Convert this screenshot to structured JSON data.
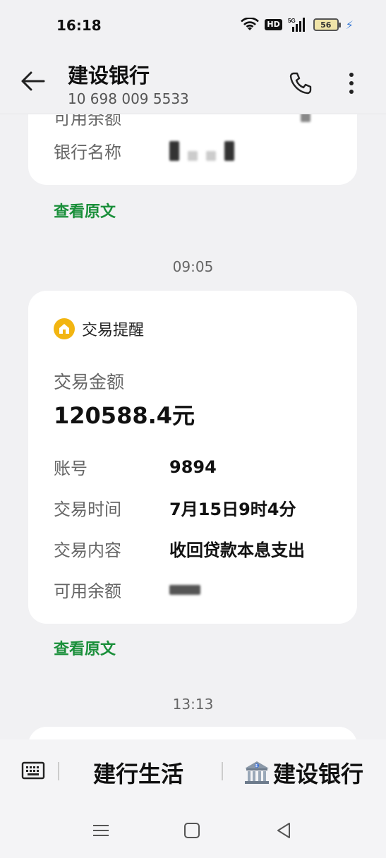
{
  "status_bar": {
    "time": "16:18",
    "hd_label": "HD",
    "network": "5G",
    "battery": "56"
  },
  "header": {
    "title": "建设银行",
    "subtitle": "10 698 009 5533"
  },
  "messages": {
    "top_card": {
      "partial_label": "可用余额",
      "bank_name_label": "银行名称"
    },
    "view_original_1": "查看原文",
    "timestamp_1": "09:05",
    "notification": {
      "title": "交易提醒",
      "amount_label": "交易金额",
      "amount": "120588.4元",
      "rows": [
        {
          "label": "账号",
          "value": "9894"
        },
        {
          "label": "交易时间",
          "value": "7月15日9时4分"
        },
        {
          "label": "交易内容",
          "value": "收回贷款本息支出"
        },
        {
          "label": "可用余额",
          "value": ""
        }
      ]
    },
    "view_original_2": "查看原文",
    "timestamp_2": "13:13"
  },
  "bottom_menu": {
    "item1": "建行生活",
    "item2": "建设银行"
  },
  "colors": {
    "accent_green": "#1a8f3a",
    "badge_yellow": "#f2b511",
    "background": "#f1f1f3"
  },
  "icons": [
    "back-arrow-icon",
    "phone-icon",
    "more-vertical-icon",
    "home-badge-icon",
    "keyboard-icon",
    "bank-icon",
    "menu-nav-icon",
    "home-nav-icon",
    "back-nav-icon"
  ]
}
